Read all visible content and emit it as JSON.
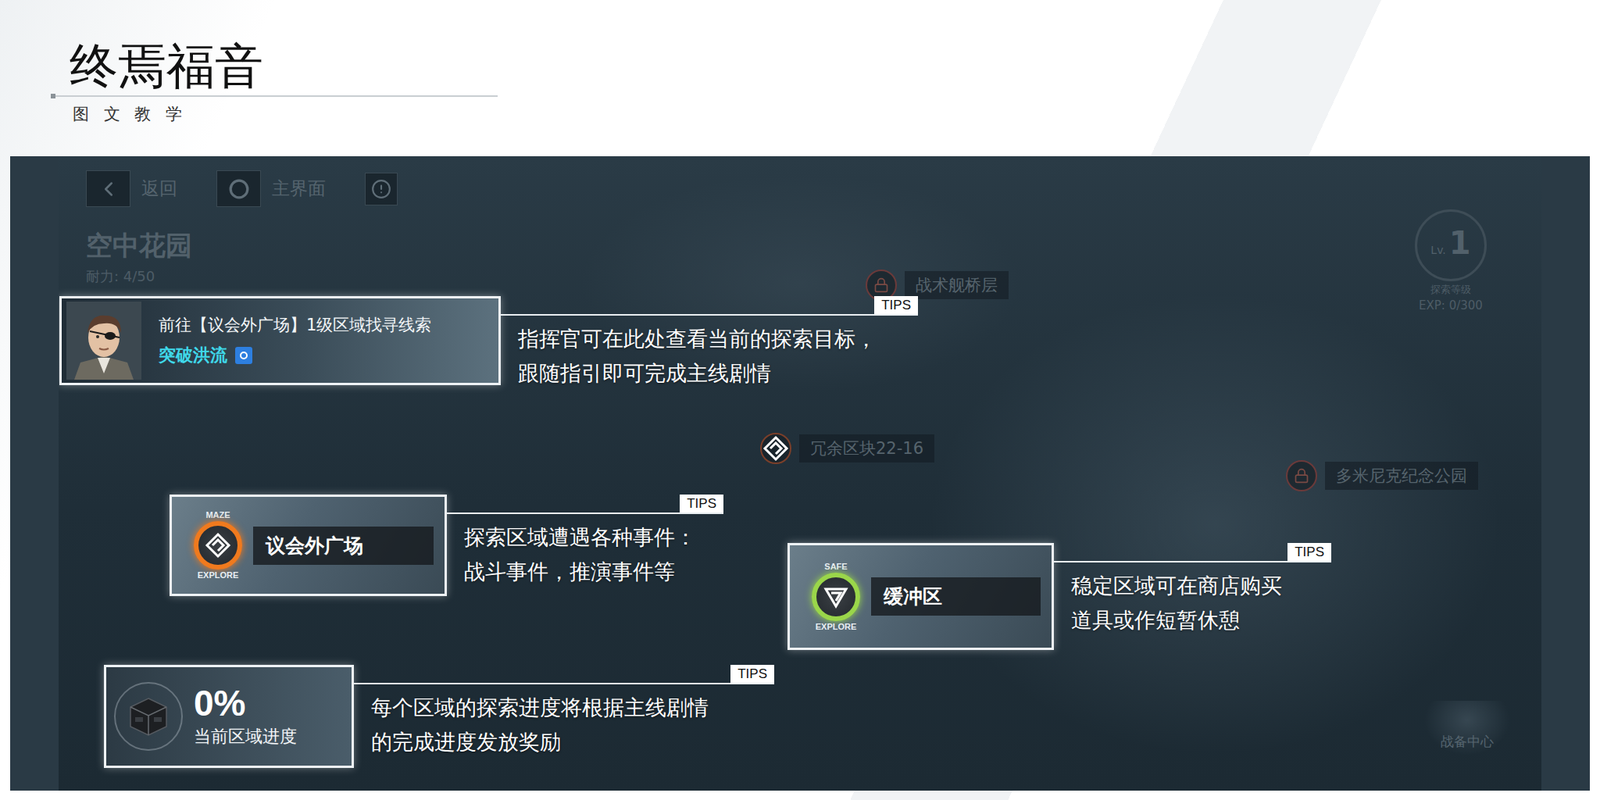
{
  "header": {
    "title": "终焉福音",
    "subtitle": "图 文 教 学"
  },
  "game": {
    "nav": [
      {
        "kind": "back",
        "label": "返回"
      },
      {
        "kind": "home",
        "label": "主界面"
      },
      {
        "kind": "alert",
        "label": ""
      }
    ],
    "area": {
      "name": "空中花园",
      "stamina": "耐力: 4/50"
    },
    "map_nodes": [
      {
        "label": "战术舰桥层",
        "locked": true
      },
      {
        "label": "冗余区块22-16",
        "locked": false
      },
      {
        "label": "多米尼克纪念公园",
        "locked": true
      }
    ],
    "level": {
      "prefix": "Lv.",
      "value": "1",
      "caption": "探索等级",
      "exp": "EXP: 0/300"
    },
    "corner_button": {
      "label": "战备中心"
    }
  },
  "callouts": [
    {
      "kind": "mission",
      "title": "前往【议会外广场】1级区域找寻线索",
      "subtitle": "突破洪流",
      "tip_label": "TIPS",
      "tip_lines": [
        "指挥官可在此处查看当前的探索目标，",
        "跟随指引即可完成主线剧情"
      ]
    },
    {
      "kind": "zone",
      "badge_top": "MAZE",
      "badge_bottom": "EXPLORE",
      "name": "议会外广场",
      "color": "#f07a1e",
      "tip_label": "TIPS",
      "tip_lines": [
        "探索区域遭遇各种事件：",
        "战斗事件，推演事件等"
      ]
    },
    {
      "kind": "zone",
      "badge_top": "SAFE",
      "badge_bottom": "EXPLORE",
      "name": "缓冲区",
      "color": "#9ad64a",
      "tip_label": "TIPS",
      "tip_lines": [
        "稳定区域可在商店购买",
        "道具或作短暂休憩"
      ]
    },
    {
      "kind": "progress",
      "value": "0%",
      "label": "当前区域进度",
      "tip_label": "TIPS",
      "tip_lines": [
        "每个区域的探索进度将根据主线剧情",
        "的完成进度发放奖励"
      ]
    }
  ]
}
